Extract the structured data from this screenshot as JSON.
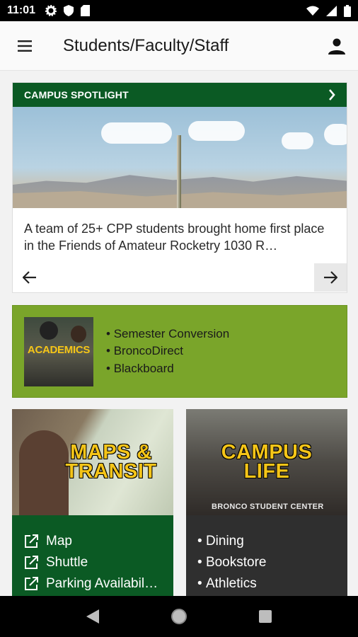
{
  "status_bar": {
    "time": "11:01",
    "left_icons": [
      "gear-icon",
      "shield-icon",
      "sdcard-icon"
    ],
    "right_icons": [
      "wifi-icon",
      "signal-icon",
      "battery-icon"
    ]
  },
  "app_bar": {
    "title": "Students/Faculty/Staff",
    "menu_icon": "menu-icon",
    "account_icon": "account-icon"
  },
  "spotlight": {
    "header": "CAMPUS SPOTLIGHT",
    "text": "A team of 25+ CPP students brought home first place in the Friends of Amateur Rocketry 1030 R…"
  },
  "academics": {
    "image_label": "ACADEMICS",
    "items": [
      "Semester Conversion",
      "BroncoDirect",
      "Blackboard"
    ]
  },
  "maps": {
    "title_line1": "MAPS &",
    "title_line2": "TRANSIT",
    "items": [
      "Map",
      "Shuttle",
      "Parking Availabil…"
    ]
  },
  "campus_life": {
    "title_line1": "CAMPUS",
    "title_line2": "LIFE",
    "sign": "BRONCO STUDENT CENTER",
    "items": [
      "Dining",
      "Bookstore",
      "Athletics"
    ]
  },
  "colors": {
    "green_dark": "#0b5a24",
    "green_light": "#7aa52a",
    "gold": "#f5c518",
    "charcoal": "#2f2f2f"
  }
}
